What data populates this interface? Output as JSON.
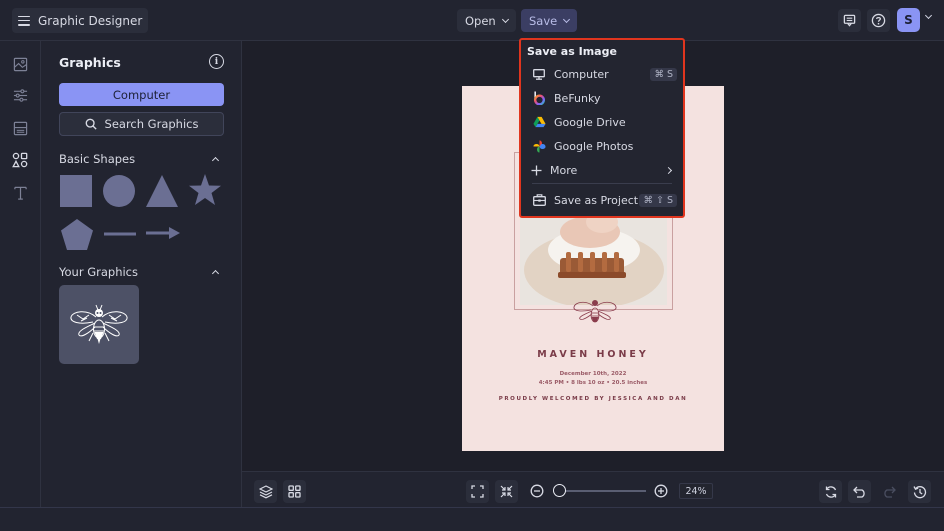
{
  "app": {
    "title": "Graphic Designer"
  },
  "topbar": {
    "open_label": "Open",
    "save_label": "Save",
    "avatar_initial": "S"
  },
  "rail": {
    "items": [
      {
        "name": "image-icon",
        "label": "Image"
      },
      {
        "name": "adjust-icon",
        "label": "Adjust"
      },
      {
        "name": "layout-icon",
        "label": "Layout"
      },
      {
        "name": "graphics-icon",
        "label": "Graphics",
        "active": true
      },
      {
        "name": "text-icon",
        "label": "Text"
      }
    ]
  },
  "panel": {
    "title": "Graphics",
    "computer_button": "Computer",
    "search_button": "Search Graphics",
    "basic_shapes_label": "Basic Shapes",
    "shapes": [
      "square",
      "circle",
      "triangle",
      "star",
      "pentagon",
      "line",
      "arrow"
    ],
    "your_graphics_label": "Your Graphics",
    "your_graphics": [
      "bee-graphic"
    ]
  },
  "save_menu": {
    "header": "Save as Image",
    "items": [
      {
        "label": "Computer",
        "icon": "monitor-icon",
        "shortcut": "⌘ S"
      },
      {
        "label": "BeFunky",
        "icon": "befunky-icon"
      },
      {
        "label": "Google Drive",
        "icon": "google-drive-icon"
      },
      {
        "label": "Google Photos",
        "icon": "google-photos-icon"
      },
      {
        "label": "More",
        "icon": "plus-icon",
        "submenu": true
      }
    ],
    "project": {
      "label": "Save as Project",
      "icon": "briefcase-icon",
      "shortcut": "⌘ ⇧ S"
    },
    "highlight_color": "#e0351e"
  },
  "document": {
    "title": "MAVEN HONEY",
    "date": "December 10th, 2022",
    "details": "4:45 PM • 8 lbs 10 oz • 20.5 inches",
    "subtitle": "PROUDLY WELCOMED BY JESSICA AND DAN",
    "background": "#f4e2e0",
    "accent": "#7a3b48"
  },
  "bottombar": {
    "zoom_percent": "24%",
    "zoom_value": 24
  },
  "colors": {
    "accent": "#8a94f4",
    "bg": "#222430"
  }
}
